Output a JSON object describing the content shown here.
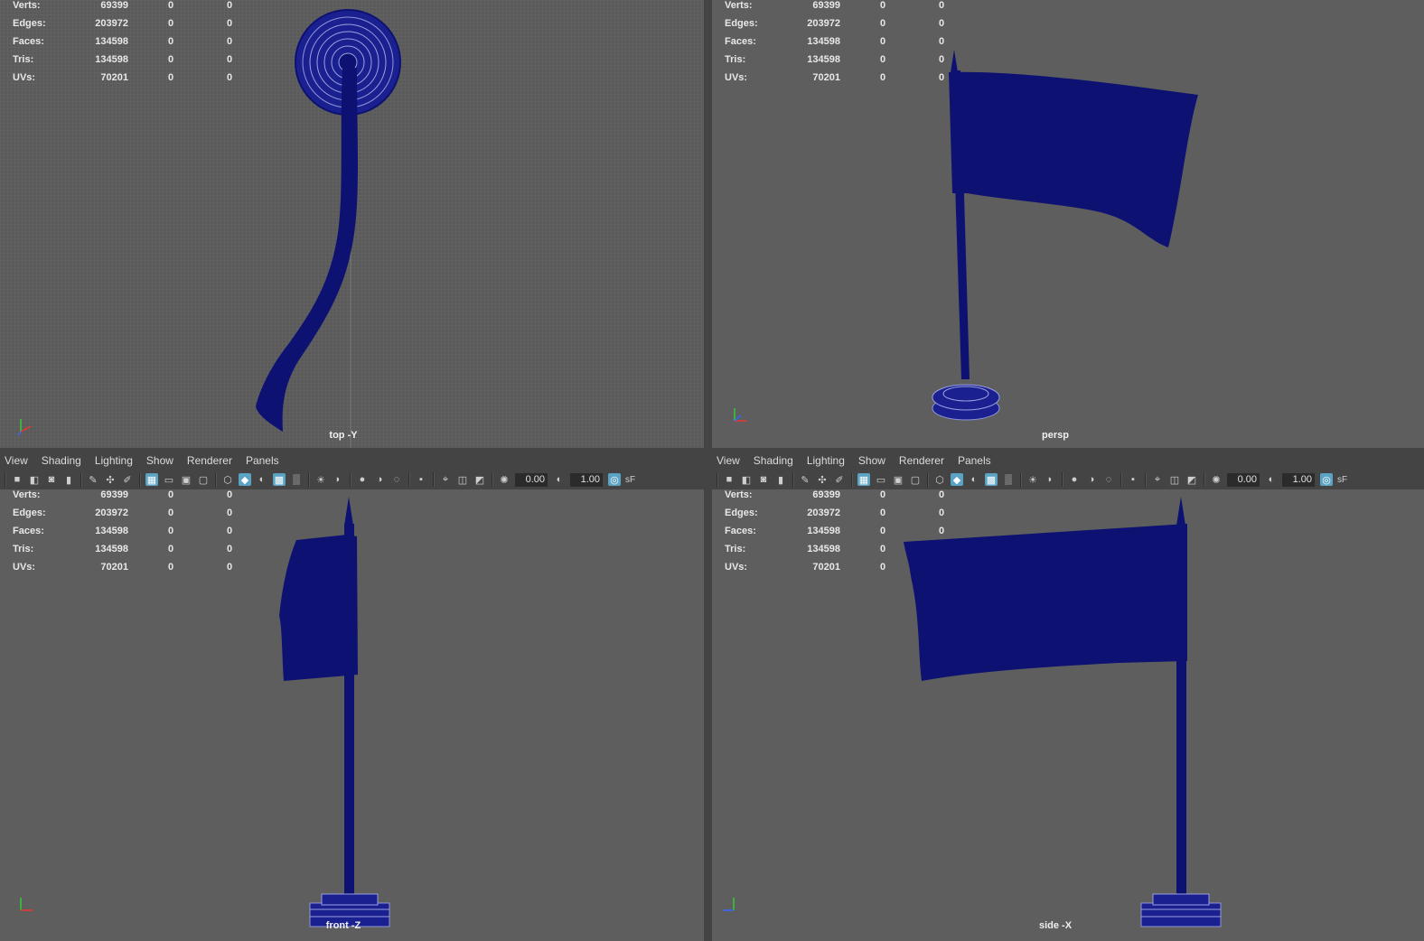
{
  "hud": {
    "rows": [
      {
        "label": "Verts:",
        "v1": "69399",
        "v2": "0",
        "v3": "0"
      },
      {
        "label": "Edges:",
        "v1": "203972",
        "v2": "0",
        "v3": "0"
      },
      {
        "label": "Faces:",
        "v1": "134598",
        "v2": "0",
        "v3": "0"
      },
      {
        "label": "Tris:",
        "v1": "134598",
        "v2": "0",
        "v3": "0"
      },
      {
        "label": "UVs:",
        "v1": "70201",
        "v2": "0",
        "v3": "0"
      }
    ]
  },
  "viewports": {
    "top": {
      "camera": "top -Y"
    },
    "persp": {
      "camera": "persp"
    },
    "front": {
      "camera": "front -Z"
    },
    "side": {
      "camera": "side -X"
    }
  },
  "menu": {
    "items": [
      "View",
      "Shading",
      "Lighting",
      "Show",
      "Renderer",
      "Panels"
    ]
  },
  "toolbar": {
    "exposure": "0.00",
    "gamma": "1.00",
    "sf_label": "sF"
  },
  "colors": {
    "mesh": "#0d1272",
    "viewport_bg": "#5e5e5e",
    "highlight": "#5aa3c3"
  },
  "icons": {
    "toolbar": [
      "camera-icon",
      "lock-camera-icon",
      "camera-attributes-icon",
      "bookmark-icon",
      "grease-pencil-icon",
      "snap-icon",
      "image-plane-icon",
      "grid-icon",
      "film-gate-icon",
      "resolution-gate-icon",
      "safe-action-icon",
      "wireframe-icon",
      "smooth-shade-icon",
      "default-material-icon",
      "wireframe-on-shaded-icon",
      "xray-icon",
      "use-all-lights-icon",
      "shadows-icon",
      "screen-space-ao-icon",
      "motion-blur-icon",
      "anti-aliasing-icon",
      "depth-of-field-icon",
      "isolate-select-icon",
      "xray-joints-icon",
      "backface-culling-icon",
      "exposure-icon",
      "gamma-icon",
      "color-management-icon"
    ]
  }
}
